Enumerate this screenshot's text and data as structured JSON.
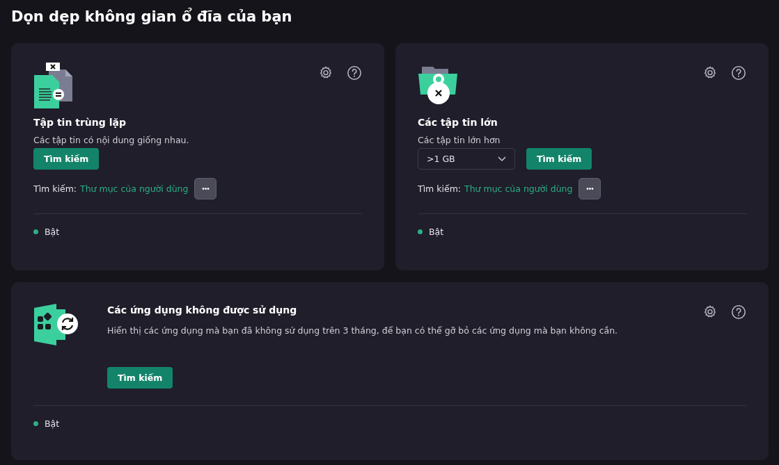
{
  "page_title": "Dọn dẹp không gian ổ đĩa của bạn",
  "cards": [
    {
      "kind": "duplicates",
      "title": "Tập tin trùng lặp",
      "description": "Các tập tin có nội dung giống nhau.",
      "button": "Tìm kiếm",
      "scope_label": "Tìm kiếm:",
      "scope_link": "Thư mục của người dùng",
      "more": "•••",
      "status": {
        "on": true,
        "label": "Bật"
      }
    },
    {
      "kind": "large",
      "title": "Các tập tin lớn",
      "description": "Các tập tin lớn hơn",
      "size_value": ">1 GB",
      "button": "Tìm kiếm",
      "scope_label": "Tìm kiếm:",
      "scope_link": "Thư mục của người dùng",
      "more": "•••",
      "status": {
        "on": true,
        "label": "Bật"
      }
    },
    {
      "kind": "apps",
      "title": "Các ứng dụng không được sử dụng",
      "description": "Hiển thị các ứng dụng mà bạn đã không sử dụng trên 3 tháng, để bạn có thể gỡ bỏ các ứng dụng mà bạn không cần.",
      "button": "Tìm kiếm",
      "status": {
        "on": true,
        "label": "Bật"
      }
    }
  ]
}
